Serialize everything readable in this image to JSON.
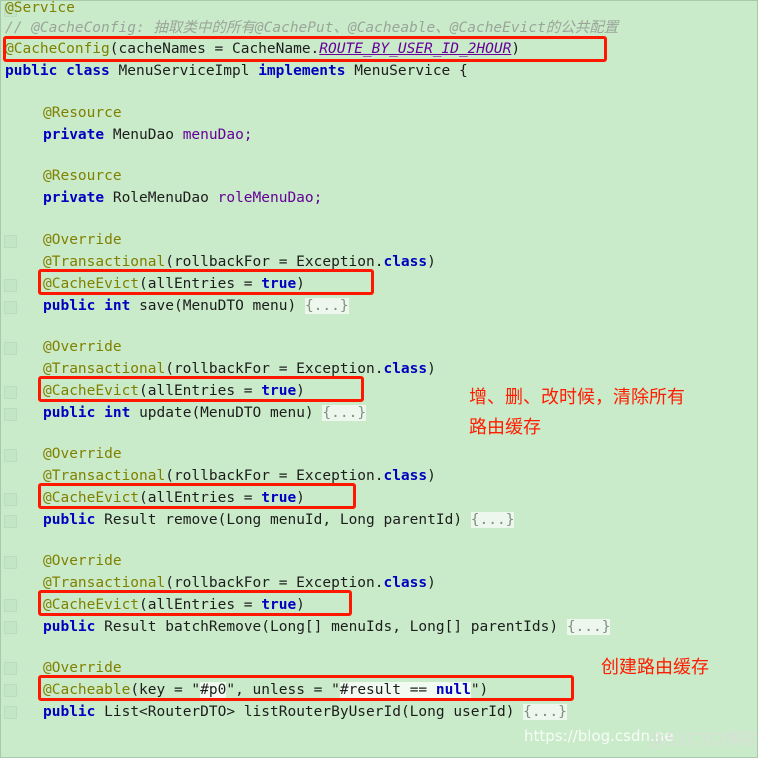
{
  "editor": {
    "background_color": "#c9ebc9",
    "highlight_color": "#ff1800",
    "annotation_color": "#ff1c00",
    "language": "Java",
    "code_lines": [
      {
        "id": "l1",
        "text": "@Service"
      },
      {
        "id": "l2",
        "text": "// @CacheConfig: 抽取类中的所有@CachePut、@Cacheable、@CacheEvict的公共配置"
      },
      {
        "id": "l3",
        "text": "@CacheConfig(cacheNames = CacheName.ROUTE_BY_USER_ID_2HOUR)"
      },
      {
        "id": "l4",
        "text": "public class MenuServiceImpl implements MenuService {"
      },
      {
        "id": "l5",
        "text": "@Resource"
      },
      {
        "id": "l6",
        "text": "private MenuDao menuDao;"
      },
      {
        "id": "l7",
        "text": "@Resource"
      },
      {
        "id": "l8",
        "text": "private RoleMenuDao roleMenuDao;"
      },
      {
        "id": "l9",
        "text": "@Override"
      },
      {
        "id": "l10",
        "text": "@Transactional(rollbackFor = Exception.class)"
      },
      {
        "id": "l11",
        "text": "@CacheEvict(allEntries = true)"
      },
      {
        "id": "l12",
        "text": "public int save(MenuDTO menu) {...}"
      },
      {
        "id": "l13",
        "text": "@Override"
      },
      {
        "id": "l14",
        "text": "@Transactional(rollbackFor = Exception.class)"
      },
      {
        "id": "l15",
        "text": "@CacheEvict(allEntries = true)"
      },
      {
        "id": "l16",
        "text": "public int update(MenuDTO menu) {...}"
      },
      {
        "id": "l17",
        "text": "@Override"
      },
      {
        "id": "l18",
        "text": "@Transactional(rollbackFor = Exception.class)"
      },
      {
        "id": "l19",
        "text": "@CacheEvict(allEntries = true)"
      },
      {
        "id": "l20",
        "text": "public Result remove(Long menuId, Long parentId) {...}"
      },
      {
        "id": "l21",
        "text": "@Override"
      },
      {
        "id": "l22",
        "text": "@Transactional(rollbackFor = Exception.class)"
      },
      {
        "id": "l23",
        "text": "@CacheEvict(allEntries = true)"
      },
      {
        "id": "l24",
        "text": "public Result batchRemove(Long[] menuIds, Long[] parentIds) {...}"
      },
      {
        "id": "l25",
        "text": "@Override"
      },
      {
        "id": "l26",
        "text": "@Cacheable(key = \"#p0\", unless = \"#result == null\")"
      },
      {
        "id": "l27",
        "text": "public List<RouterDTO> listRouterByUserId(Long userId) {...}"
      }
    ],
    "tokens": {
      "service_anno": "@Service",
      "comment_line": "// @CacheConfig: 抽取类中的所有@CachePut、@Cacheable、@CacheEvict的公共配置",
      "cacheconfig_anno": "@CacheConfig",
      "cacheconfig_args_pre": "(cacheNames = CacheName.",
      "cacheconfig_constant": "ROUTE_BY_USER_ID_2HOUR",
      "cacheconfig_args_post": ")",
      "kw_public": "public",
      "kw_class": "class",
      "class_name": "MenuServiceImpl",
      "kw_implements": "implements",
      "interface_name": "MenuService",
      "brace_open": "{",
      "resource_anno": "@Resource",
      "kw_private": "private",
      "type_menudao": "MenuDao",
      "field_menudao": "menuDao;",
      "type_rolemenudao": "RoleMenuDao",
      "field_rolemenudao": "roleMenuDao;",
      "override_anno": "@Override",
      "transactional_anno": "@Transactional",
      "transactional_args_pre": "(rollbackFor = Exception.",
      "kw_class_ref": "class",
      "transactional_args_post": ")",
      "cacheevict_anno": "@CacheEvict",
      "cacheevict_args_pre": "(allEntries = ",
      "bool_true": "true",
      "cacheevict_args_post": ")",
      "kw_int": "int",
      "sig_save": "save(MenuDTO menu)",
      "sig_update": "update(MenuDTO menu)",
      "type_result": "Result",
      "sig_remove": "remove(Long menuId, Long parentId)",
      "sig_batchremove": "batchRemove(Long[] menuIds, Long[] parentIds)",
      "type_list_router": "List<RouterDTO>",
      "sig_listrouter": "listRouterByUserId(Long userId)",
      "fold_block": "{...}",
      "cacheable_anno": "@Cacheable",
      "cacheable_pre": "(key = \"",
      "cacheable_spel_key": "#p0",
      "cacheable_mid": "\", unless = \"",
      "cacheable_spel_hash": "#result == ",
      "cacheable_spel_null": "null",
      "cacheable_post": "\")"
    },
    "annotations": [
      {
        "id": "note1",
        "line1": "增、删、改时候，清除所有",
        "line2": "路由缓存"
      },
      {
        "id": "note2",
        "line1": "创建路由缓存"
      }
    ],
    "watermarks": {
      "csdn": "https://blog.csdn.ne",
      "cto": "@51CTO博客"
    }
  }
}
